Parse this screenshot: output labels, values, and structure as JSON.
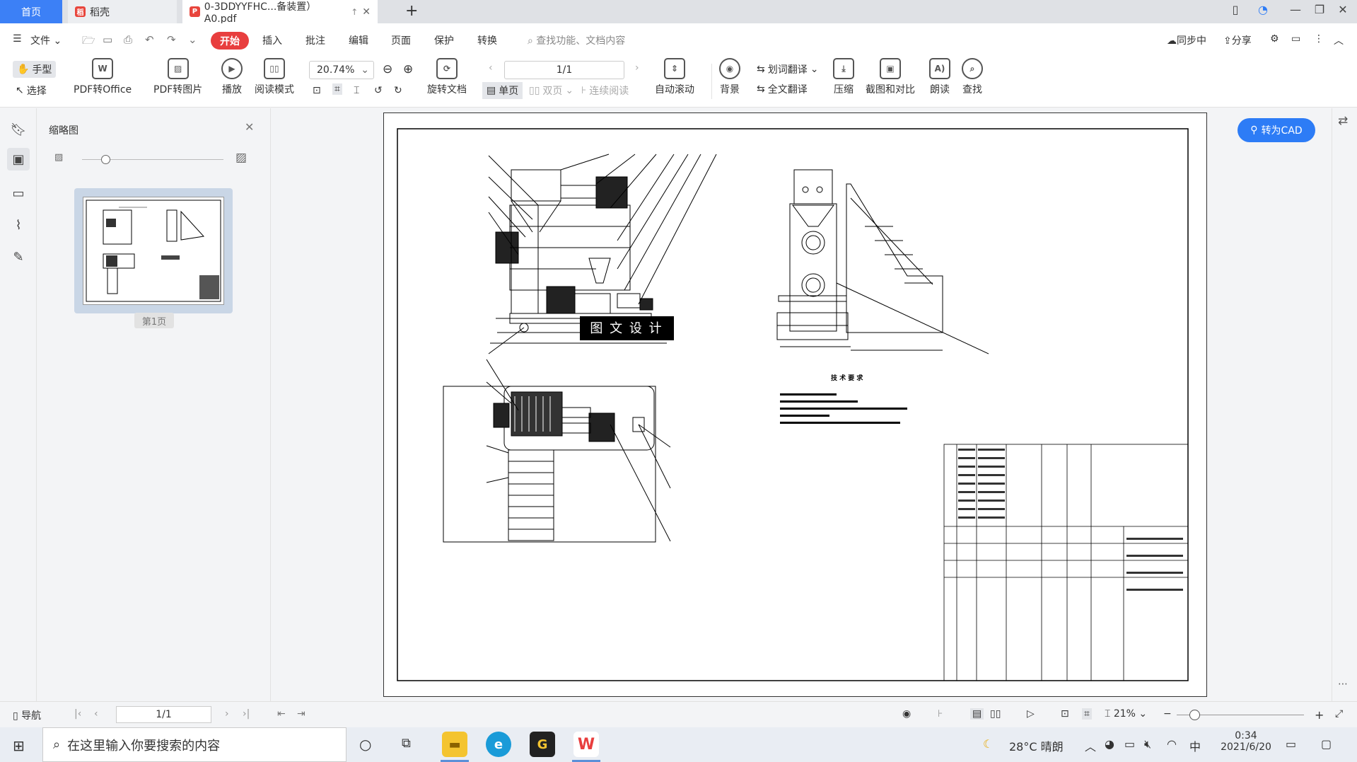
{
  "tabs": {
    "home": "首页",
    "shell": "稻壳",
    "doc": "0-3DDYYFHC...备装置）A0.pdf"
  },
  "menu": {
    "file": "文件",
    "items": [
      "开始",
      "插入",
      "批注",
      "编辑",
      "页面",
      "保护",
      "转换"
    ],
    "search_placeholder": "查找功能、文档内容",
    "sync": "同步中",
    "share": "分享"
  },
  "ribbon": {
    "hand": "手型",
    "select": "选择",
    "pdf_to_office": "PDF转Office",
    "pdf_to_image": "PDF转图片",
    "play": "播放",
    "read_mode": "阅读模式",
    "zoom": "20.74%",
    "page": "1/1",
    "rotate": "旋转文档",
    "single": "单页",
    "double": "双页",
    "continuous": "连续阅读",
    "auto_scroll": "自动滚动",
    "background": "背景",
    "word_translate": "划词翻译",
    "full_translate": "全文翻译",
    "compress": "压缩",
    "screenshot_compare": "截图和对比",
    "read_aloud": "朗读",
    "find": "查找"
  },
  "thumbnail": {
    "title": "缩略图",
    "page_label": "第1页"
  },
  "doc": {
    "watermark": "图 文 设 计",
    "tech_title": "技 术 要 求",
    "to_cad": "转为CAD"
  },
  "status": {
    "nav": "导航",
    "page": "1/1",
    "zoom": "21%"
  },
  "taskbar": {
    "search_placeholder": "在这里输入你要搜索的内容",
    "weather": "28°C 晴朗",
    "ime": "中",
    "time": "0:34",
    "date": "2021/6/20"
  },
  "colors": {
    "accent_blue": "#3c80f6",
    "start_red": "#e83e3e",
    "cad_blue": "#2d7cf6"
  }
}
